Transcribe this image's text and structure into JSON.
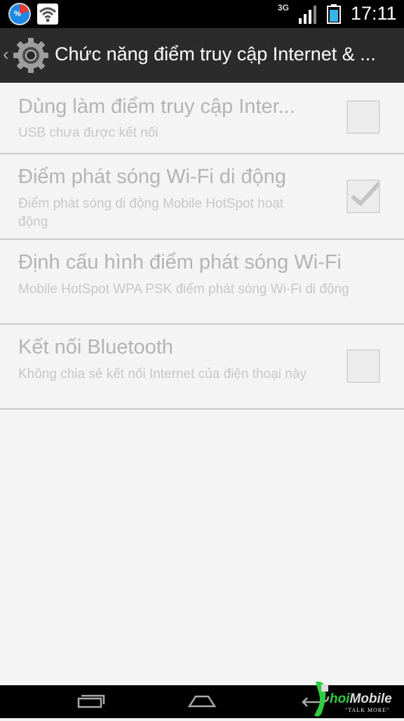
{
  "status_bar": {
    "percent_icon_label": "%",
    "network_type": "3G",
    "time": "17:11",
    "icons": [
      "percent-icon",
      "wifi-icon",
      "signal-icon",
      "battery-icon"
    ]
  },
  "action_bar": {
    "title": "Chức năng điểm truy cập Internet & ...",
    "icon": "settings-gear-icon"
  },
  "settings": [
    {
      "title": "Dùng làm điểm truy cập Inter...",
      "subtitle": "USB chưa được kết nối",
      "checkbox": true,
      "checked": false
    },
    {
      "title": "Điểm phát sóng Wi-Fi di động",
      "subtitle": "Điểm phát sóng di động Mobile HotSpot hoạt động",
      "checkbox": true,
      "checked": true
    },
    {
      "title": "Định cấu hình điểm phát sóng Wi-Fi",
      "subtitle": "Mobile HotSpot WPA PSK điểm phát sóng Wi-Fi di động",
      "checkbox": false
    },
    {
      "title": "Kết nối Bluetooth",
      "subtitle": "Không chia sẻ kết nối Internet của điện thoại này",
      "checkbox": true,
      "checked": false
    }
  ],
  "nav_bar": {
    "buttons": [
      "recent-apps-icon",
      "home-icon",
      "back-icon"
    ]
  },
  "watermark": {
    "brand_green": "hoi",
    "brand_white": "Mobile",
    "tagline": "\"TALK MORE\""
  },
  "colors": {
    "action_bar_bg": "#2b2b2b",
    "list_bg": "#f4f4f4",
    "disabled_text": "#b4b4b4",
    "divider": "#c9c9c9"
  }
}
